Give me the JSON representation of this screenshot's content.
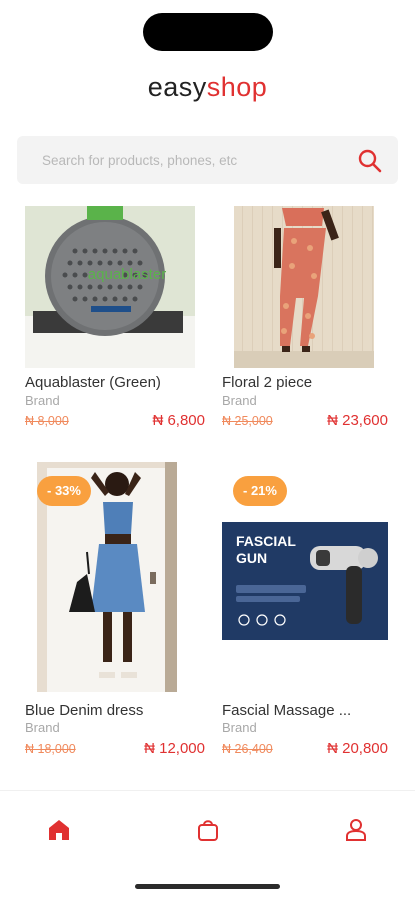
{
  "brand": {
    "part1": "easy",
    "part2": "shop"
  },
  "search": {
    "placeholder": "Search for products, phones, etc"
  },
  "products": [
    {
      "title": "Aquablaster (Green)",
      "brand": "Brand",
      "old_price": "₦ 8,000",
      "price": "₦ 6,800",
      "badge": ""
    },
    {
      "title": "Floral 2 piece",
      "brand": "Brand",
      "old_price": "₦ 25,000",
      "price": "₦ 23,600",
      "badge": ""
    },
    {
      "title": "Blue Denim dress",
      "brand": "Brand",
      "old_price": "₦ 18,000",
      "price": "₦ 12,000",
      "badge": "- 33%"
    },
    {
      "title": "Fascial Massage ...",
      "brand": "Brand",
      "old_price": "₦ 26,400",
      "price": "₦ 20,800",
      "badge": "- 21%"
    }
  ],
  "product_image_text": {
    "aquablaster": "aquablaster",
    "fascial_line1": "FASCIAL",
    "fascial_line2": "GUN"
  },
  "nav": [
    "home-icon",
    "bag-icon",
    "profile-icon"
  ],
  "colors": {
    "accent": "#e03131",
    "badge": "#f9a03f",
    "old_price": "#f08a5d"
  }
}
